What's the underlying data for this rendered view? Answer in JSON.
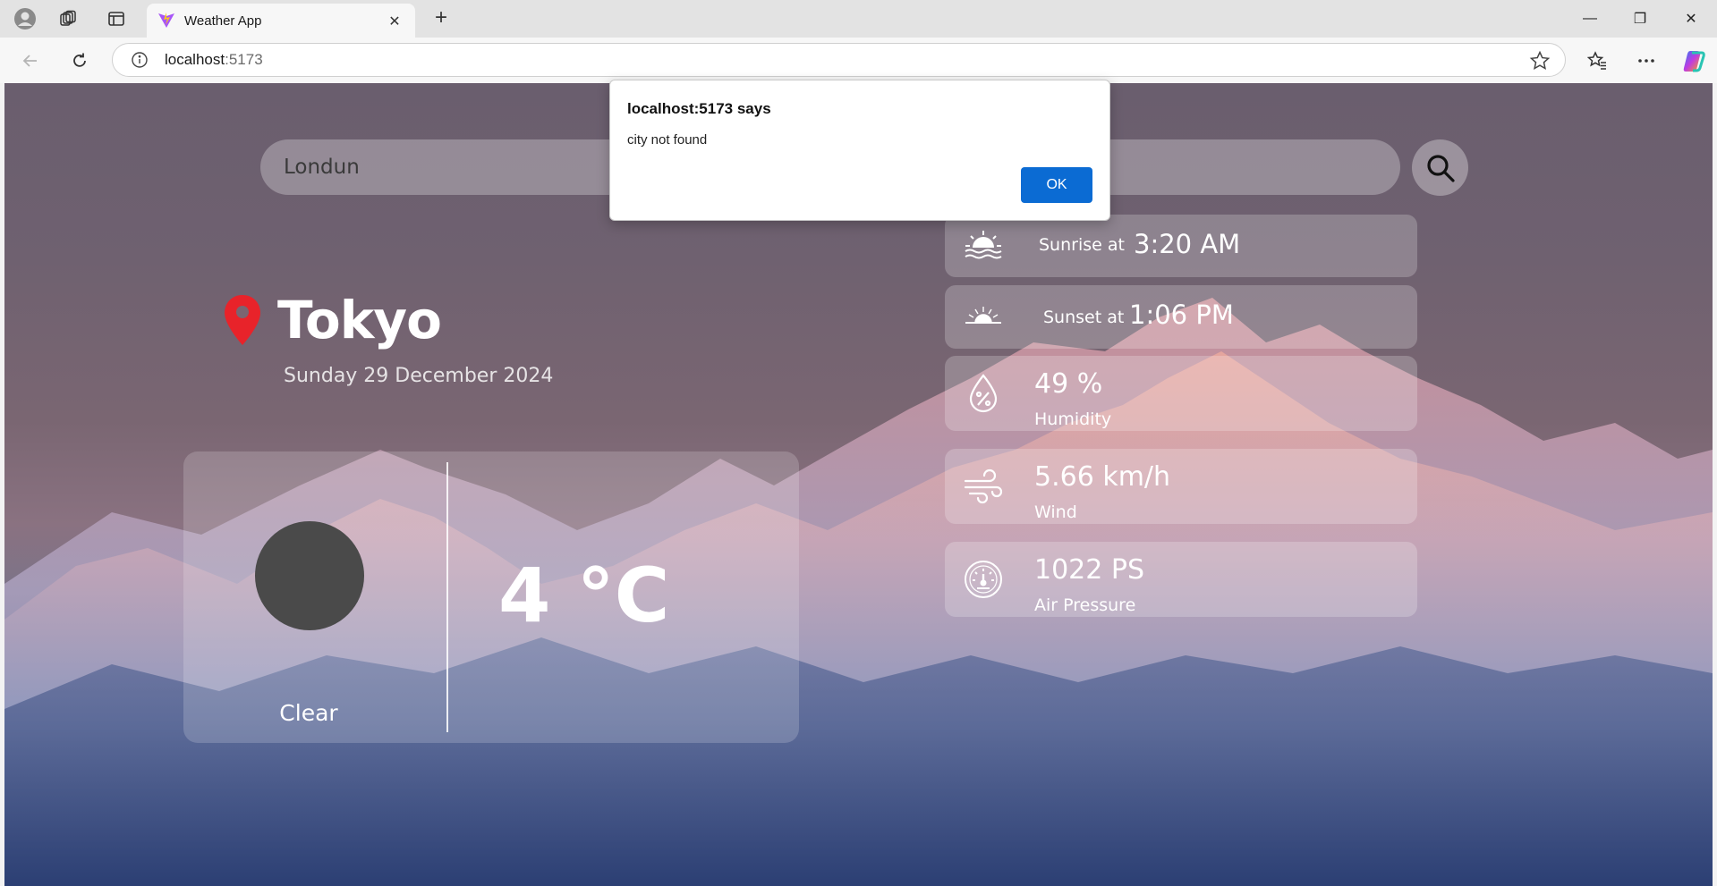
{
  "browser": {
    "tab_title": "Weather App",
    "tab_close": "✕",
    "new_tab": "+",
    "url_host": "localhost",
    "url_port": ":5173",
    "window_controls": {
      "minimize": "—",
      "restore": "❐",
      "close": "✕"
    },
    "icons": [
      "profile-icon",
      "workspaces-icon",
      "tab-actions-icon",
      "back-icon",
      "refresh-icon",
      "info-icon",
      "favorite-star-icon",
      "favorites-icon",
      "more-icon",
      "copilot-icon"
    ]
  },
  "search": {
    "value": "Londun",
    "placeholder": ""
  },
  "location": {
    "city": "Tokyo",
    "date": "Sunday 29 December 2024"
  },
  "current": {
    "temperature": "4 °C",
    "condition": "Clear"
  },
  "details": {
    "sunrise": {
      "label": "Sunrise at",
      "value": "3:20 AM"
    },
    "sunset": {
      "label": "Sunset at",
      "value": "1:06 PM"
    },
    "humidity": {
      "value": "49 %",
      "label": "Humidity"
    },
    "wind": {
      "value": "5.66 km/h",
      "label": "Wind"
    },
    "pressure": {
      "value": "1022 PS",
      "label": "Air Pressure"
    }
  },
  "alert": {
    "title": "localhost:5173 says",
    "message": "city not found",
    "ok_label": "OK",
    "ok_color": "#0b6bd3"
  },
  "colors": {
    "pin": "#e8232a",
    "text": "#ffffff"
  }
}
